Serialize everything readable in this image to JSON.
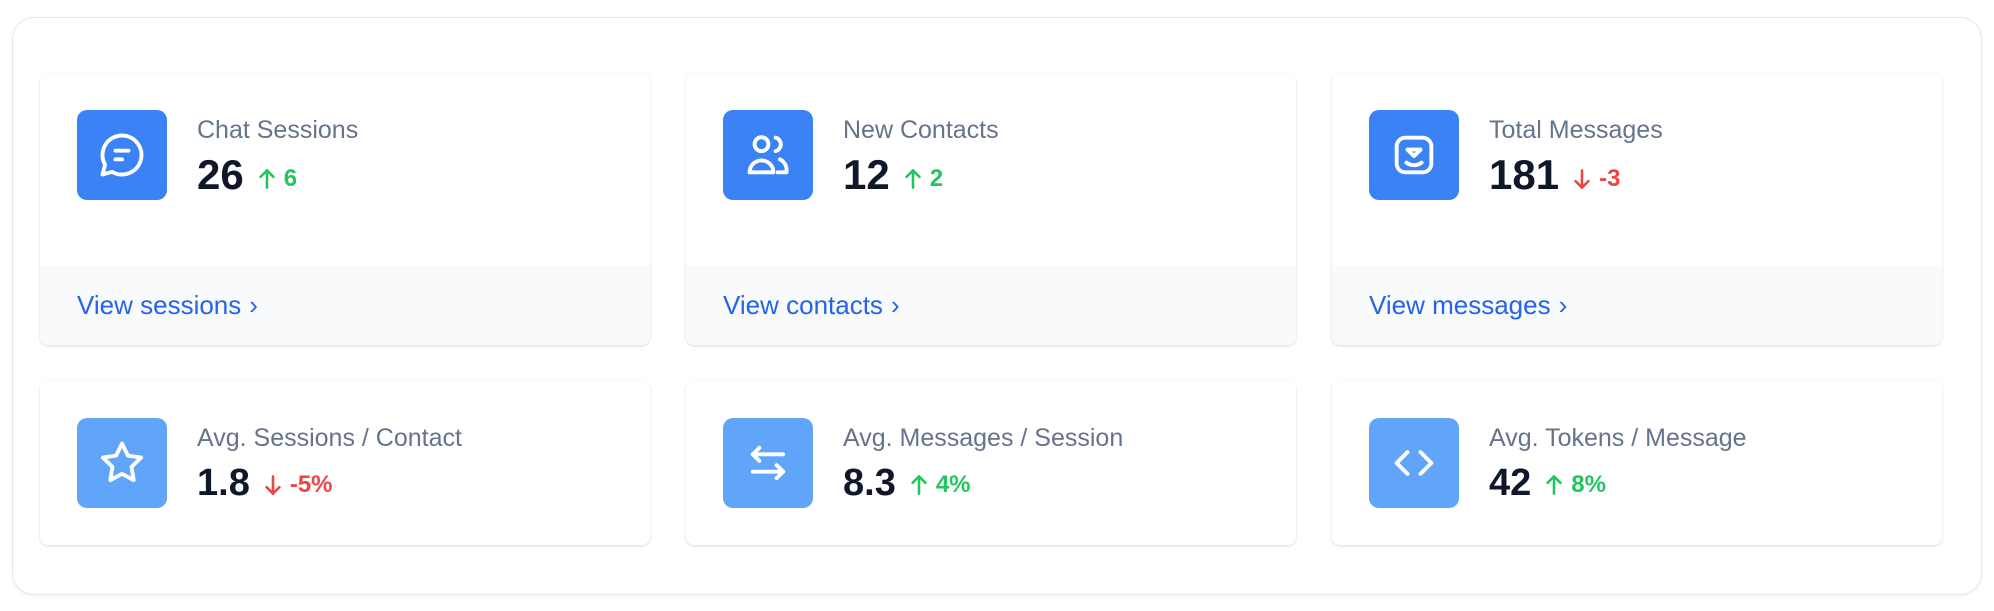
{
  "cards": [
    {
      "label": "Chat Sessions",
      "value": "26",
      "delta": "6",
      "trend": "up",
      "link": "View sessions",
      "icon": "chat-bubble-icon"
    },
    {
      "label": "New Contacts",
      "value": "12",
      "delta": "2",
      "trend": "up",
      "link": "View contacts",
      "icon": "users-icon"
    },
    {
      "label": "Total Messages",
      "value": "181",
      "delta": "-3",
      "trend": "down",
      "link": "View messages",
      "icon": "inbox-smile-icon"
    },
    {
      "label": "Avg. Sessions / Contact",
      "value": "1.8",
      "delta": "-5%",
      "trend": "down",
      "icon": "star-icon"
    },
    {
      "label": "Avg. Messages / Session",
      "value": "8.3",
      "delta": "4%",
      "trend": "up",
      "icon": "arrows-exchange-icon"
    },
    {
      "label": "Avg. Tokens / Message",
      "value": "42",
      "delta": "8%",
      "trend": "up",
      "icon": "code-icon"
    }
  ],
  "link_chevron": "›",
  "colors": {
    "primary": "#3b82f6",
    "primary_light": "#60a5fa",
    "up": "#22c55e",
    "down": "#ef4444",
    "link": "#2563eb"
  }
}
